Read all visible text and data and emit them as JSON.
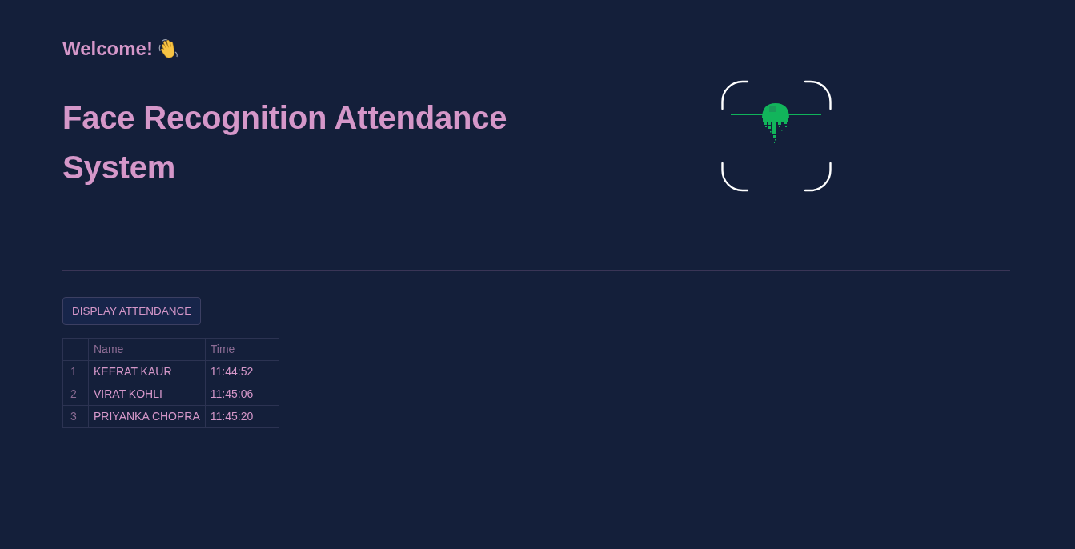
{
  "greeting": {
    "text": "Welcome!"
  },
  "title": "Face Recognition Attendance System",
  "button": {
    "label": "DISPLAY ATTENDANCE"
  },
  "table": {
    "columns": [
      "Name",
      "Time"
    ],
    "rows": [
      {
        "index": "1",
        "cells": [
          "KEERAT KAUR",
          "11:44:52"
        ]
      },
      {
        "index": "2",
        "cells": [
          "VIRAT KOHLI",
          "11:45:06"
        ]
      },
      {
        "index": "3",
        "cells": [
          "PRIYANKA CHOPRA",
          "11:45:20"
        ]
      }
    ]
  }
}
